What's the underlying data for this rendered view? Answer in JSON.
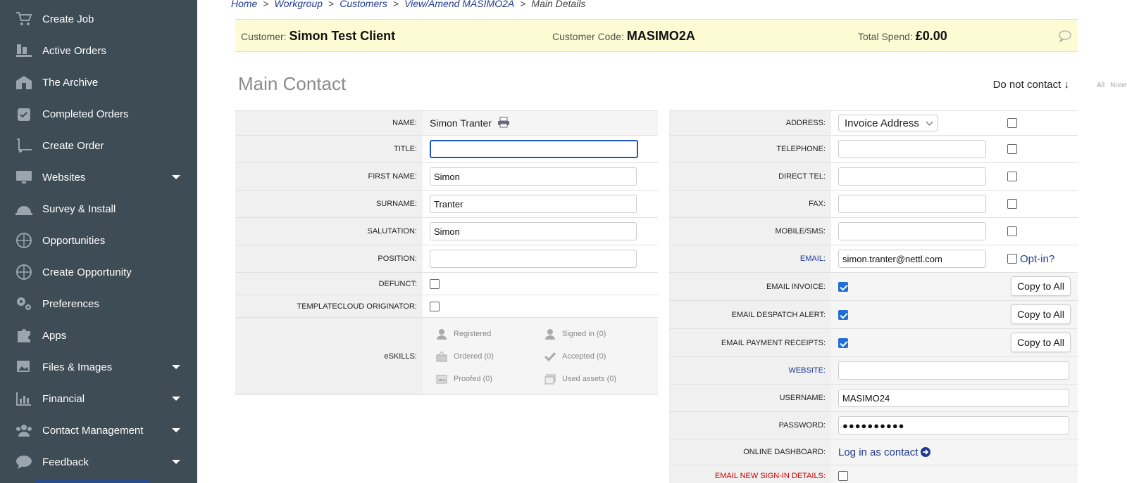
{
  "sidebar": {
    "items": [
      {
        "label": "Create Job",
        "icon": "cart-plus-icon",
        "has_caret": false
      },
      {
        "label": "Active Orders",
        "icon": "orders-icon",
        "has_caret": false
      },
      {
        "label": "The Archive",
        "icon": "archive-icon",
        "has_caret": false
      },
      {
        "label": "Completed Orders",
        "icon": "calendar-check-icon",
        "has_caret": false
      },
      {
        "label": "Create Order",
        "icon": "dolly-icon",
        "has_caret": false
      },
      {
        "label": "Websites",
        "icon": "monitor-icon",
        "has_caret": true
      },
      {
        "label": "Survey & Install",
        "icon": "hard-hat-icon",
        "has_caret": false
      },
      {
        "label": "Opportunities",
        "icon": "basket-icon",
        "has_caret": false
      },
      {
        "label": "Create Opportunity",
        "icon": "basket-plus-icon",
        "has_caret": false
      },
      {
        "label": "Preferences",
        "icon": "cogs-icon",
        "has_caret": false
      },
      {
        "label": "Apps",
        "icon": "puzzle-icon",
        "has_caret": false
      },
      {
        "label": "Files & Images",
        "icon": "images-icon",
        "has_caret": true
      },
      {
        "label": "Financial",
        "icon": "bar-chart-icon",
        "has_caret": true
      },
      {
        "label": "Contact Management",
        "icon": "users-icon",
        "has_caret": true
      },
      {
        "label": "Feedback",
        "icon": "speech-bubble-icon",
        "has_caret": true
      }
    ]
  },
  "breadcrumb": {
    "home": "Home",
    "workgroup": "Workgroup",
    "customers": "Customers",
    "view_amend": "View/Amend MASIMO2A",
    "current": "Main Details",
    "sep": ">"
  },
  "customer_bar": {
    "customer_label": "Customer:",
    "customer_value": "Simon Test Client",
    "code_label": "Customer Code:",
    "code_value": "MASIMO2A",
    "spend_label": "Total Spend:",
    "spend_value": "£0.00"
  },
  "section_title": "Main Contact",
  "do_not_contact": {
    "label": "Do not contact ↓",
    "all": "All",
    "none": "None"
  },
  "left_form": {
    "name_label": "NAME:",
    "name_value": "Simon Tranter",
    "title_label": "TITLE:",
    "title_value": "",
    "first_name_label": "FIRST NAME:",
    "first_name_value": "Simon",
    "surname_label": "SURNAME:",
    "surname_value": "Tranter",
    "salutation_label": "SALUTATION:",
    "salutation_value": "Simon",
    "position_label": "POSITION:",
    "position_value": "",
    "defunct_label": "DEFUNCT:",
    "defunct_checked": false,
    "templatecloud_label": "TEMPLATECLOUD ORIGINATOR:",
    "templatecloud_checked": false,
    "eskills_label": "eSKILLS:",
    "eskills": {
      "registered": "Registered",
      "signed_in": "Signed in (0)",
      "ordered": "Ordered (0)",
      "accepted": "Accepted (0)",
      "proofed": "Proofed (0)",
      "used_assets": "Used assets (0)"
    }
  },
  "right_form": {
    "address_label": "ADDRESS:",
    "address_value": "Invoice Address",
    "telephone_label": "TELEPHONE:",
    "telephone_value": "",
    "direct_tel_label": "DIRECT TEL:",
    "direct_tel_value": "",
    "fax_label": "FAX:",
    "fax_value": "",
    "mobile_label": "MOBILE/SMS:",
    "mobile_value": "",
    "email_label": "EMAIL:",
    "email_value": "simon.tranter@nettl.com",
    "opt_in_label": "Opt-in?",
    "email_invoice_label": "EMAIL INVOICE:",
    "email_despatch_label": "EMAIL DESPATCH ALERT:",
    "email_payment_label": "EMAIL PAYMENT RECEIPTS:",
    "copy_to_all": "Copy to All",
    "website_label": "WEBSITE:",
    "website_value": "",
    "username_label": "USERNAME:",
    "username_value": "MASIMO24",
    "password_label": "PASSWORD:",
    "password_value": "●●●●●●●●●●",
    "dashboard_label": "ONLINE DASHBOARD:",
    "dashboard_link": "Log in as contact",
    "email_signin_label": "EMAIL NEW SIGN-IN DETAILS:"
  },
  "colors": {
    "sidebar_bg": "#3d4c55",
    "customer_bar_bg": "#fdfbd4",
    "link": "#1f3b8f",
    "checkbox_on": "#1f6fd6"
  }
}
